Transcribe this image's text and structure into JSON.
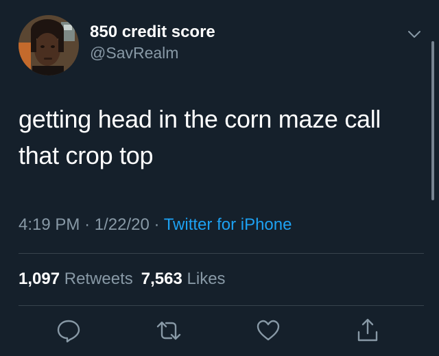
{
  "user": {
    "display_name": "850 credit score",
    "handle": "@SavRealm",
    "avatar_icon": "profile-photo"
  },
  "tweet": {
    "text_line1": "getting head in the corn maze call",
    "text_line2": "that crop top",
    "time": "4:19 PM",
    "date": "1/22/20",
    "separator": "·",
    "source": "Twitter for iPhone"
  },
  "stats": {
    "retweets_count": "1,097",
    "retweets_label": "Retweets",
    "likes_count": "7,563",
    "likes_label": "Likes"
  },
  "actions": [
    "reply-icon",
    "retweet-icon",
    "like-icon",
    "share-icon"
  ],
  "colors": {
    "background": "#15202b",
    "secondary_text": "#8899a6",
    "link": "#1da1f2",
    "divider": "#38444d"
  }
}
